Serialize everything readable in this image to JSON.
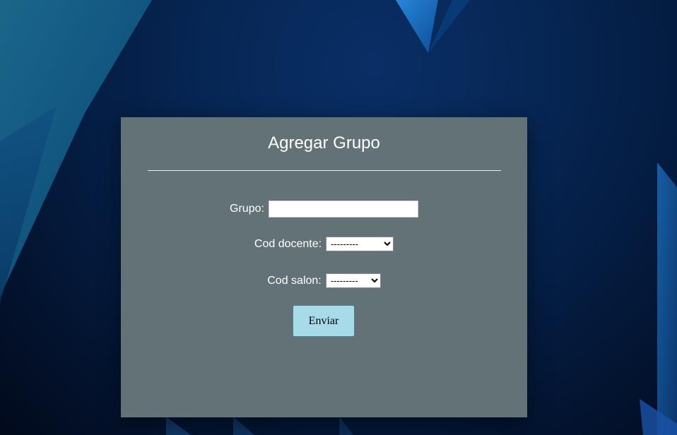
{
  "form": {
    "title": "Agregar Grupo",
    "fields": {
      "grupo": {
        "label": "Grupo:",
        "value": "",
        "placeholder": ""
      },
      "cod_docente": {
        "label": "Cod docente:",
        "selected": "---------"
      },
      "cod_salon": {
        "label": "Cod salon:",
        "selected": "---------"
      }
    },
    "submit_label": "Enviar"
  },
  "colors": {
    "card_background": "#627276",
    "button_background": "#a8dbe9",
    "wallpaper_base": "#062552"
  }
}
